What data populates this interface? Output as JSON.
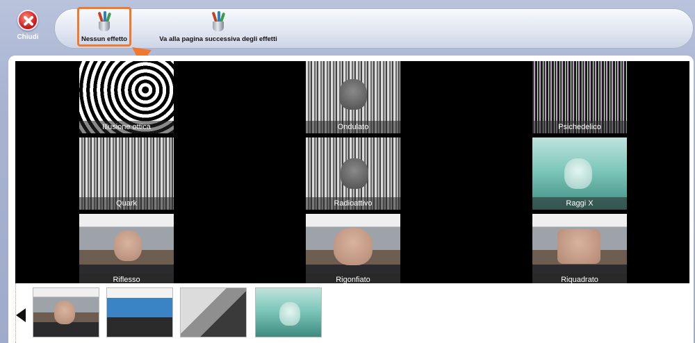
{
  "close": {
    "label": "Chiudi"
  },
  "toolbar": {
    "none_label": "Nessun effetto",
    "next_label": "Va alla pagina successiva degli effetti",
    "highlight_color": "#ef7a2e"
  },
  "effects": [
    {
      "label": "Illusione ottica"
    },
    {
      "label": "Ondulato"
    },
    {
      "label": "Psichedelico"
    },
    {
      "label": "Quark"
    },
    {
      "label": "Radioattivo"
    },
    {
      "label": "Raggi X"
    },
    {
      "label": "Riflesso"
    },
    {
      "label": "Rigonfiato"
    },
    {
      "label": "Riquadrato"
    }
  ],
  "thumbnail_count": 4
}
